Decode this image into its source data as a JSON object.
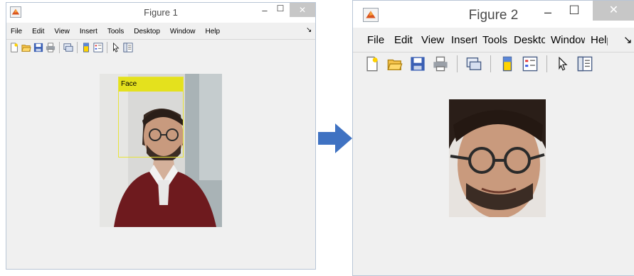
{
  "figure1": {
    "title": "Figure 1",
    "min_glyph": "–",
    "max_glyph": "☐",
    "close_glyph": "✕",
    "menu": [
      "File",
      "Edit",
      "View",
      "Insert",
      "Tools",
      "Desktop",
      "Window",
      "Help"
    ],
    "menu_overflow_glyph": "↘",
    "toolbar_icons": [
      "new-figure-icon",
      "open-file-icon",
      "save-icon",
      "print-icon",
      "link-plot-icon",
      "colorbar-icon",
      "legend-icon",
      "pointer-icon",
      "property-editor-icon"
    ],
    "detection_label": "Face"
  },
  "figure2": {
    "title": "Figure 2",
    "min_glyph": "–",
    "max_glyph": "☐",
    "close_glyph": "✕",
    "menu": [
      "File",
      "Edit",
      "View",
      "Insert",
      "Tools",
      "Desktop",
      "Window",
      "Help"
    ],
    "menu_overflow_glyph": "↘",
    "toolbar_icons": [
      "new-figure-icon",
      "open-file-icon",
      "save-icon",
      "print-icon",
      "link-plot-icon",
      "colorbar-icon",
      "legend-icon",
      "pointer-icon",
      "property-editor-icon"
    ]
  },
  "colors": {
    "window_bg": "#f0f0f0",
    "detection_box": "#e4e11d",
    "arrow": "#3f72c2",
    "close_button": "#c7c7c7"
  }
}
